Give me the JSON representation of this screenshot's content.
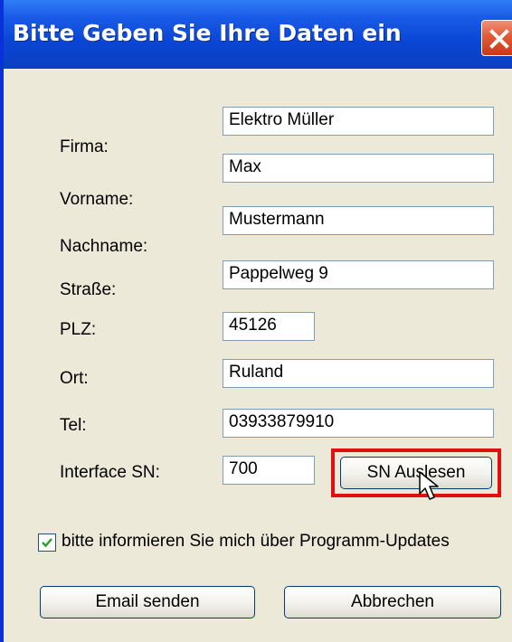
{
  "window": {
    "title": "Bitte Geben Sie Ihre Daten ein"
  },
  "form": {
    "firma_label": "Firma:",
    "firma_value": "Elektro Müller",
    "vorname_label": "Vorname:",
    "vorname_value": "Max",
    "nachname_label": "Nachname:",
    "nachname_value": "Mustermann",
    "strasse_label": "Straße:",
    "strasse_value": "Pappelweg 9",
    "plz_label": "PLZ:",
    "plz_value": "45126",
    "ort_label": "Ort:",
    "ort_value": "Ruland",
    "tel_label": "Tel:",
    "tel_value": "03933879910",
    "sn_label": "Interface SN:",
    "sn_value": "700",
    "sn_button": "SN Auslesen"
  },
  "updates": {
    "checked": true,
    "label": "bitte informieren Sie mich über Programm-Updates"
  },
  "footer": {
    "send_label": "Email senden",
    "cancel_label": "Abbrechen"
  },
  "icons": {
    "close": "close-icon",
    "check": "checkmark-icon",
    "cursor": "mouse-pointer-icon"
  },
  "colors": {
    "titlebar": "#0a46d6",
    "close": "#e25a35",
    "highlight": "#e01010",
    "checkmark": "#21a121"
  }
}
